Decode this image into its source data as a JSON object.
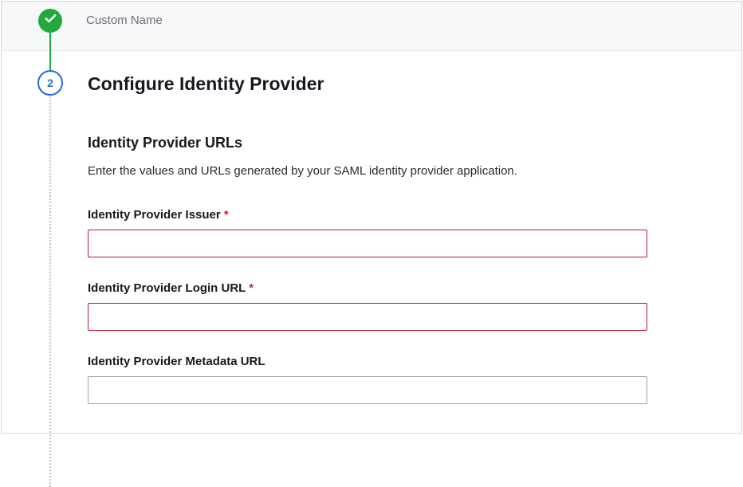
{
  "steps": {
    "completed_label": "Custom Name",
    "active_number": "2"
  },
  "page": {
    "title": "Configure Identity Provider"
  },
  "section": {
    "title": "Identity Provider URLs",
    "description": "Enter the values and URLs generated by your SAML identity provider application."
  },
  "fields": {
    "issuer": {
      "label": "Identity Provider Issuer ",
      "required": "*",
      "value": ""
    },
    "login_url": {
      "label": "Identity Provider Login URL ",
      "required": "*",
      "value": ""
    },
    "metadata_url": {
      "label": "Identity Provider Metadata URL",
      "value": ""
    }
  }
}
